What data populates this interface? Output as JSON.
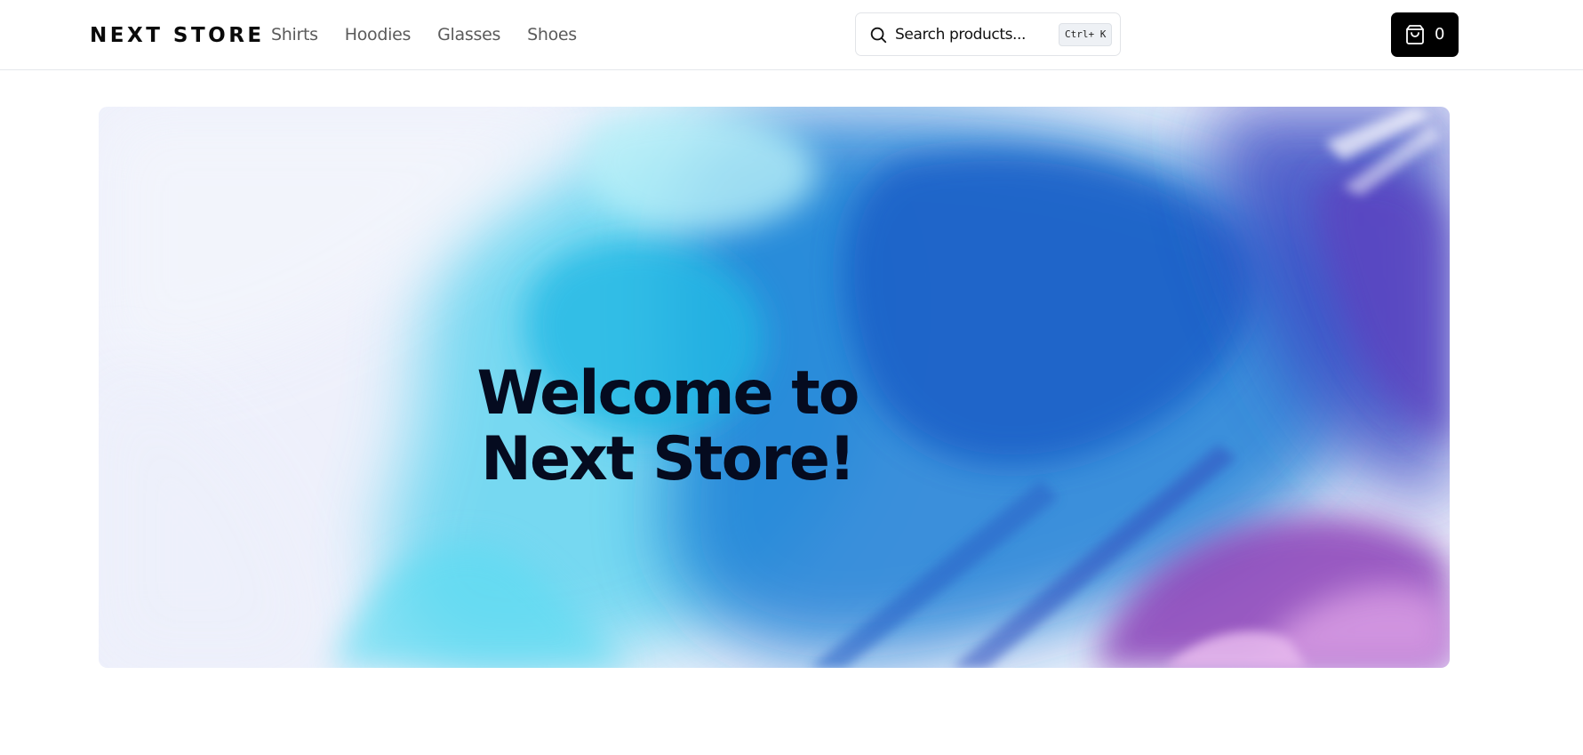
{
  "header": {
    "logo": "NEXT STORE",
    "nav": [
      "Shirts",
      "Hoodies",
      "Glasses",
      "Shoes"
    ],
    "search": {
      "placeholder": "Search products...",
      "shortcut": "Ctrl+ K",
      "icon": "search-icon"
    },
    "cart": {
      "count": "0",
      "icon": "shopping-bag-icon"
    }
  },
  "hero": {
    "title": "Welcome to Next Store!"
  },
  "colors": {
    "cart_bg": "#000000",
    "nav_text": "#5b5b5b",
    "title_text": "#050b1f"
  }
}
